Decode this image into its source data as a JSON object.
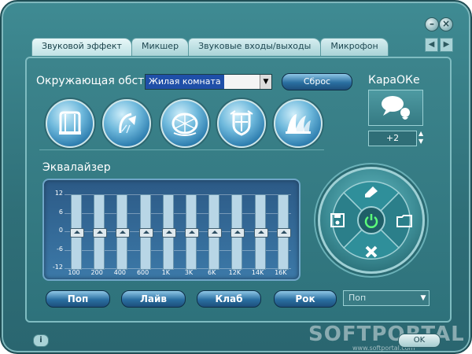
{
  "tabs": [
    "Звуковой эффект",
    "Микшер",
    "Звуковые входы/выходы",
    "Микрофон"
  ],
  "environment": {
    "label": "Окружающая обст",
    "value": "Жилая комната",
    "reset_label": "Сброс"
  },
  "karaoke": {
    "title": "КараОКе",
    "value": "+2"
  },
  "equalizer": {
    "title": "Эквалайзер",
    "db_ticks": [
      "12",
      "6",
      "0",
      "-6",
      "-12"
    ],
    "bands": [
      {
        "label": "100",
        "gain": 0
      },
      {
        "label": "200",
        "gain": 0
      },
      {
        "label": "400",
        "gain": 0
      },
      {
        "label": "600",
        "gain": 0
      },
      {
        "label": "1K",
        "gain": 0
      },
      {
        "label": "3K",
        "gain": 0
      },
      {
        "label": "6K",
        "gain": 0
      },
      {
        "label": "12K",
        "gain": 0
      },
      {
        "label": "14K",
        "gain": 0
      },
      {
        "label": "16K",
        "gain": 0
      }
    ]
  },
  "presets": {
    "buttons": [
      "Поп",
      "Лайв",
      "Клаб",
      "Рок"
    ],
    "selected": "Поп"
  },
  "footer": {
    "info": "i",
    "ok": "OK"
  },
  "watermark": {
    "brand": "SOFTPORTAL",
    "url": "www.softportal.com"
  }
}
